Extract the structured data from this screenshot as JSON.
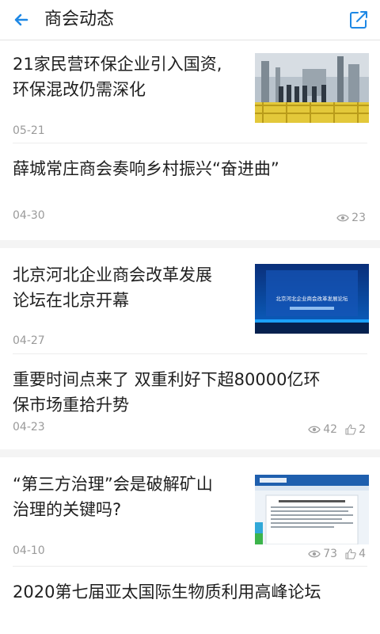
{
  "header": {
    "title": "商会动态"
  },
  "articles": [
    {
      "title_line1": "21家民营环保企业引入国资,",
      "title_line2": "环保混改仍需深化",
      "date": "05-21"
    },
    {
      "title": "薛城常庄商会奏响乡村振兴“奋进曲”",
      "date": "04-30",
      "views": "23"
    },
    {
      "title_line1": "北京河北企业商会改革发展",
      "title_line2": "论坛在北京开幕",
      "date": "04-27",
      "thumb_top": "北京河北企业商会改革发展论坛"
    },
    {
      "title_line1": "重要时间点来了 双重利好下超80000亿环",
      "title_line2": "保市场重拾升势",
      "date": "04-23",
      "views": "42",
      "likes": "2"
    },
    {
      "title_line1": "“第三方治理”会是破解矿山",
      "title_line2": "治理的关键吗?",
      "date": "04-10",
      "views": "73",
      "likes": "4"
    },
    {
      "title": "2020第七届亚太国际生物质利用高峰论坛"
    }
  ],
  "colors": {
    "accent": "#1e88e5",
    "muted": "#9a9a9a"
  }
}
